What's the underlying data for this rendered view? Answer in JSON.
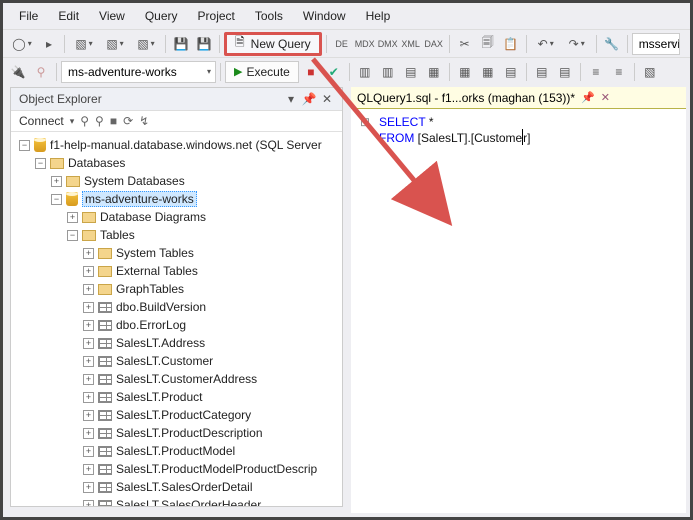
{
  "menu": [
    "File",
    "Edit",
    "View",
    "Query",
    "Project",
    "Tools",
    "Window",
    "Help"
  ],
  "toolbar1": {
    "new_query": "New Query",
    "server_box": "msservi"
  },
  "toolbar2": {
    "db_combo": "ms-adventure-works",
    "execute": "Execute"
  },
  "explorer": {
    "title": "Object Explorer",
    "connect": "Connect",
    "server": "f1-help-manual.database.windows.net (SQL Server",
    "databases": "Databases",
    "sysdb": "System Databases",
    "userdb": "ms-adventure-works",
    "diagrams": "Database Diagrams",
    "tables": "Tables",
    "sys_tables": "System Tables",
    "ext_tables": "External Tables",
    "graph_tables": "GraphTables",
    "leaves": [
      "dbo.BuildVersion",
      "dbo.ErrorLog",
      "SalesLT.Address",
      "SalesLT.Customer",
      "SalesLT.CustomerAddress",
      "SalesLT.Product",
      "SalesLT.ProductCategory",
      "SalesLT.ProductDescription",
      "SalesLT.ProductModel",
      "SalesLT.ProductModelProductDescrip",
      "SalesLT.SalesOrderDetail",
      "SalesLT.SalesOrderHeader"
    ]
  },
  "editor": {
    "tab": "QLQuery1.sql - f1...orks (maghan (153))*",
    "kw1": "SELECT",
    "star": "*",
    "kw2": "FROM",
    "obj_a": "[SalesLT].[Custome",
    "obj_b": "r]"
  }
}
